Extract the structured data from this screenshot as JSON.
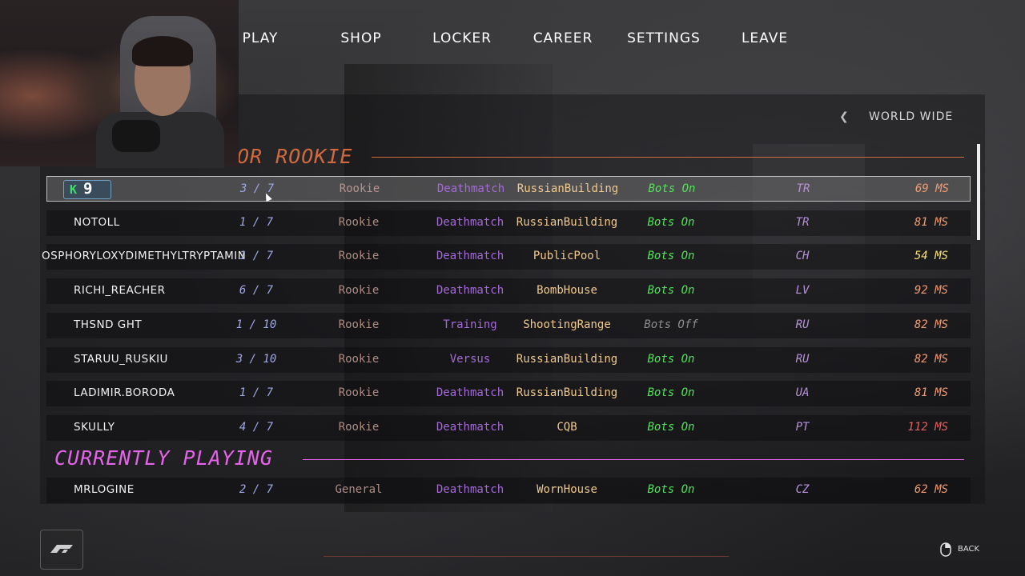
{
  "nav": {
    "items": [
      "PLAY",
      "SHOP",
      "LOCKER",
      "CAREER",
      "SETTINGS",
      "LEAVE"
    ]
  },
  "region": {
    "label": "WORLD WIDE",
    "chevron_icon": "chevron-left-icon"
  },
  "sections": {
    "rookie_title": "OR ROOKIE",
    "playing_title": "CURRENTLY PLAYING"
  },
  "colors": {
    "rookie_title": "#d2693e",
    "playing_title": "#e363e9",
    "bots_on": "#52e25a",
    "bots_off": "#8d8d8d"
  },
  "servers": [
    {
      "name": "",
      "badge": {
        "k": "K",
        "n": "9"
      },
      "players": "3 / 7",
      "rank": "Rookie",
      "mode": "Deathmatch",
      "map": "RussianBuilding",
      "bots": "Bots On",
      "country": "TR",
      "ping": "69 MS",
      "selected": true
    },
    {
      "name": "NOTOLL",
      "players": "1 / 7",
      "rank": "Rookie",
      "mode": "Deathmatch",
      "map": "RussianBuilding",
      "bots": "Bots On",
      "country": "TR",
      "ping": "81 MS"
    },
    {
      "name": "OSPHORYLOXYDIMETHYLTRYPTAMIN",
      "players": "1 / 7",
      "rank": "Rookie",
      "mode": "Deathmatch",
      "map": "PublicPool",
      "bots": "Bots On",
      "country": "CH",
      "ping": "54 MS"
    },
    {
      "name": "RICHI_REACHER",
      "players": "6 / 7",
      "rank": "Rookie",
      "mode": "Deathmatch",
      "map": "BombHouse",
      "bots": "Bots On",
      "country": "LV",
      "ping": "92 MS"
    },
    {
      "name": "THSND GHT",
      "players": "1 / 10",
      "rank": "Rookie",
      "mode": "Training",
      "map": "ShootingRange",
      "bots": "Bots Off",
      "country": "RU",
      "ping": "82 MS"
    },
    {
      "name": "STARUU_RUSKIU",
      "players": "3 / 10",
      "rank": "Rookie",
      "mode": "Versus",
      "map": "RussianBuilding",
      "bots": "Bots On",
      "country": "RU",
      "ping": "82 MS"
    },
    {
      "name": "LADIMIR.BORODA",
      "players": "1 / 7",
      "rank": "Rookie",
      "mode": "Deathmatch",
      "map": "RussianBuilding",
      "bots": "Bots On",
      "country": "UA",
      "ping": "81 MS"
    },
    {
      "name": "SKULLY",
      "players": "4 / 7",
      "rank": "Rookie",
      "mode": "Deathmatch",
      "map": "CQB",
      "bots": "Bots On",
      "country": "PT",
      "ping": "112 MS"
    }
  ],
  "playing": [
    {
      "name": "MRLOGINE",
      "players": "2 / 7",
      "rank": "General",
      "mode": "Deathmatch",
      "map": "WornHouse",
      "bots": "Bots On",
      "country": "CZ",
      "ping": "62 MS"
    }
  ],
  "footer": {
    "back_label": "BACK",
    "logo_icon": "game-logo-icon",
    "mouse_icon": "mouse-icon"
  }
}
